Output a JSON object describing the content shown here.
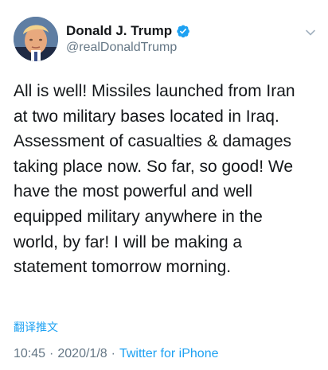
{
  "author": {
    "display_name": "Donald J. Trump",
    "handle": "@realDonaldTrump",
    "verified_icon": "verified-badge-icon",
    "avatar_icon": "avatar"
  },
  "tweet": {
    "text": "All is well! Missiles launched from Iran\nat two military bases located in Iraq.\nAssessment of casualties & damages\ntaking place now. So far, so good! We\nhave the most powerful and well\nequipped military anywhere in the\nworld, by far! I will be making a\nstatement tomorrow morning."
  },
  "actions": {
    "translate_label": "翻译推文",
    "more_icon": "chevron-down-icon"
  },
  "meta": {
    "time": "10:45",
    "separator_1": "·",
    "date": "2020/1/8",
    "separator_2": "·",
    "source": "Twitter for iPhone"
  },
  "colors": {
    "link": "#1da1f2",
    "secondary_text": "#657786",
    "primary_text": "#14171a"
  }
}
